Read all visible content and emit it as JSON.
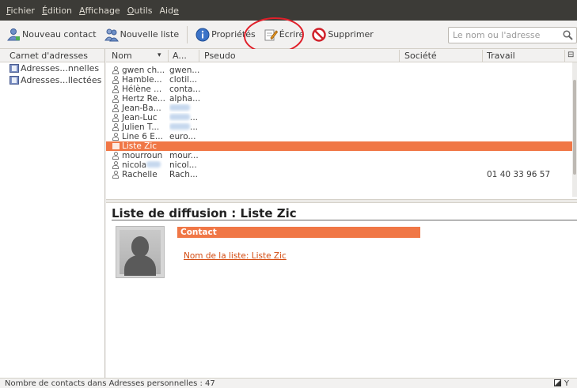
{
  "menu": [
    {
      "first": "F",
      "rest": "ichier"
    },
    {
      "first": "É",
      "rest": "dition"
    },
    {
      "first": "A",
      "rest": "ffichage"
    },
    {
      "first": "O",
      "rest": "utils"
    },
    {
      "first": "Aid",
      "rest": "e"
    }
  ],
  "menu_labels": [
    "Fichier",
    "Édition",
    "Affichage",
    "Outils",
    "Aide"
  ],
  "toolbar": {
    "new_contact": "Nouveau contact",
    "new_list": "Nouvelle liste",
    "properties": "Propriétés",
    "write": "Écrire",
    "delete": "Supprimer",
    "search_placeholder": "Le nom ou l'adresse"
  },
  "left_pane": {
    "header": "Carnet d'adresses",
    "books": [
      "Adresses...nnelles",
      "Adresses...llectées"
    ]
  },
  "list": {
    "columns": {
      "name": "Nom",
      "email": "A...",
      "pseudo": "Pseudo",
      "company": "Société",
      "work": "Travail"
    },
    "rows": [
      {
        "name": "gwen ch...",
        "email": "gwen...",
        "type": "person",
        "selected": false,
        "work": ""
      },
      {
        "name": "Hamble...",
        "email": "clotil...",
        "type": "person",
        "selected": false,
        "work": ""
      },
      {
        "name": "Hélène ...",
        "email": "conta...",
        "type": "person",
        "selected": false,
        "work": ""
      },
      {
        "name": "Hertz Re...",
        "email": "alpha...",
        "type": "person",
        "selected": false,
        "work": ""
      },
      {
        "name": "Jean-Ba...",
        "email": "",
        "blur": true,
        "type": "person",
        "selected": false,
        "work": ""
      },
      {
        "name": "Jean-Luc",
        "email": "...",
        "blur": true,
        "type": "person",
        "selected": false,
        "work": ""
      },
      {
        "name": "Julien T...",
        "email": "...",
        "blur": true,
        "type": "person",
        "selected": false,
        "work": ""
      },
      {
        "name": "Line 6 E...",
        "email": "euro...",
        "type": "person",
        "selected": false,
        "work": ""
      },
      {
        "name": "Liste Zic",
        "email": "",
        "type": "list",
        "selected": true,
        "work": ""
      },
      {
        "name": "mourroun",
        "email": "mour...",
        "type": "person",
        "selected": false,
        "work": ""
      },
      {
        "name": "nicola",
        "email": "nicol...",
        "blurname": true,
        "type": "person",
        "selected": false,
        "work": ""
      },
      {
        "name": "Rachelle",
        "email": "Rach...",
        "type": "person",
        "selected": false,
        "work": "01 40 33 96 57"
      }
    ]
  },
  "detail": {
    "title": "Liste de diffusion : Liste Zic",
    "section": "Contact",
    "list_name": "Nom de la liste: Liste Zic"
  },
  "status": {
    "text": "Nombre de contacts dans Adresses personnelles : 47",
    "right": "Y"
  },
  "colors": {
    "accent": "#f07746",
    "menubar": "#3c3b37",
    "link": "#d34a0f"
  }
}
